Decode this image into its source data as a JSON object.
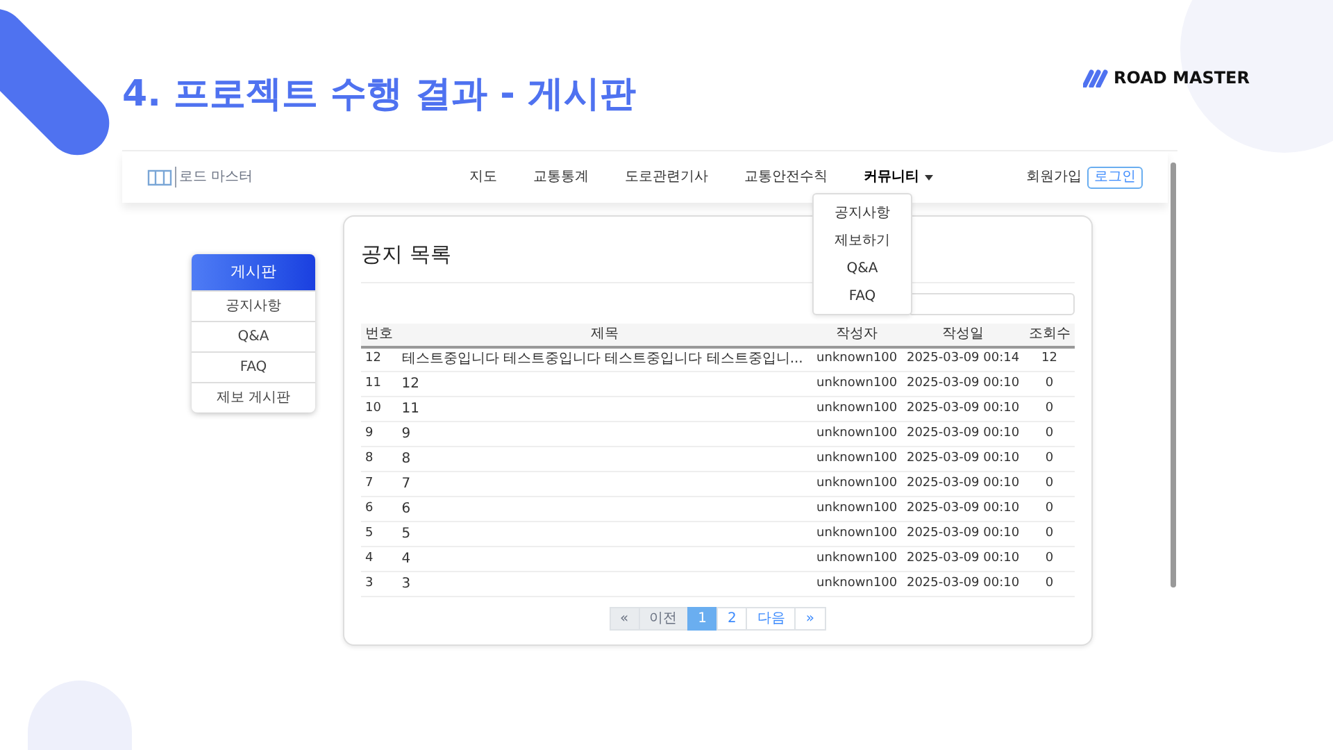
{
  "slide": {
    "title": "4. 프로젝트 수행 결과 - 게시판",
    "brand": "ROAD MASTER"
  },
  "navbar": {
    "logo": "로드 마스터",
    "menu": [
      {
        "label": "지도",
        "active": false
      },
      {
        "label": "교통통계",
        "active": false
      },
      {
        "label": "도로관련기사",
        "active": false
      },
      {
        "label": "교통안전수칙",
        "active": false
      },
      {
        "label": "커뮤니티",
        "active": true,
        "expanded": true
      }
    ],
    "signup": "회원가입",
    "login": "로그인"
  },
  "dropdown": [
    "공지사항",
    "제보하기",
    "Q&A",
    "FAQ"
  ],
  "sidebar": {
    "title": "게시판",
    "items": [
      "공지사항",
      "Q&A",
      "FAQ",
      "제보 게시판"
    ]
  },
  "board": {
    "title": "공지 목록",
    "columns": [
      "번호",
      "제목",
      "작성자",
      "작성일",
      "조회수"
    ],
    "rows": [
      [
        "12",
        "테스트중입니다 테스트중입니다 테스트중입니다 테스트중입니...",
        "unknown100",
        "2025-03-09 00:14",
        "12"
      ],
      [
        "11",
        "12",
        "unknown100",
        "2025-03-09 00:10",
        "0"
      ],
      [
        "10",
        "11",
        "unknown100",
        "2025-03-09 00:10",
        "0"
      ],
      [
        "9",
        "9",
        "unknown100",
        "2025-03-09 00:10",
        "0"
      ],
      [
        "8",
        "8",
        "unknown100",
        "2025-03-09 00:10",
        "0"
      ],
      [
        "7",
        "7",
        "unknown100",
        "2025-03-09 00:10",
        "0"
      ],
      [
        "6",
        "6",
        "unknown100",
        "2025-03-09 00:10",
        "0"
      ],
      [
        "5",
        "5",
        "unknown100",
        "2025-03-09 00:10",
        "0"
      ],
      [
        "4",
        "4",
        "unknown100",
        "2025-03-09 00:10",
        "0"
      ],
      [
        "3",
        "3",
        "unknown100",
        "2025-03-09 00:10",
        "0"
      ]
    ],
    "pagination": [
      {
        "label": "«",
        "kind": "first",
        "selected": false
      },
      {
        "label": "이전",
        "kind": "prev",
        "selected": false
      },
      {
        "label": "1",
        "kind": "page",
        "selected": true
      },
      {
        "label": "2",
        "kind": "page",
        "selected": false
      },
      {
        "label": "다음",
        "kind": "next",
        "selected": false
      },
      {
        "label": "»",
        "kind": "last",
        "selected": false
      }
    ]
  }
}
